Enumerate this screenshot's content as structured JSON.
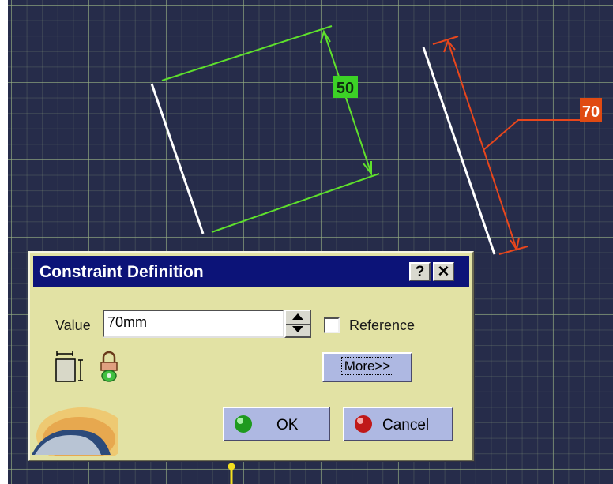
{
  "viewport": {
    "dimension_green": "50",
    "dimension_red": "70",
    "colors": {
      "background": "#262c4a",
      "grid": "#96af82",
      "selected_line": "#ffffff",
      "green_constraint": "#5ee02c",
      "red_constraint": "#e8461c",
      "axis_marker": "#f4e020"
    }
  },
  "dialog": {
    "title": "Constraint Definition",
    "help_label": "?",
    "close_label": "✕",
    "value_label": "Value",
    "value": "70mm",
    "reference_label": "Reference",
    "reference_checked": false,
    "more_label": "More>>",
    "ok_label": "OK",
    "cancel_label": "Cancel",
    "icons": {
      "dimension": "dimension-icon",
      "lock": "lock-icon",
      "ok": "green-ball-icon",
      "cancel": "red-ball-icon",
      "help": "help-icon",
      "close": "close-icon"
    }
  }
}
